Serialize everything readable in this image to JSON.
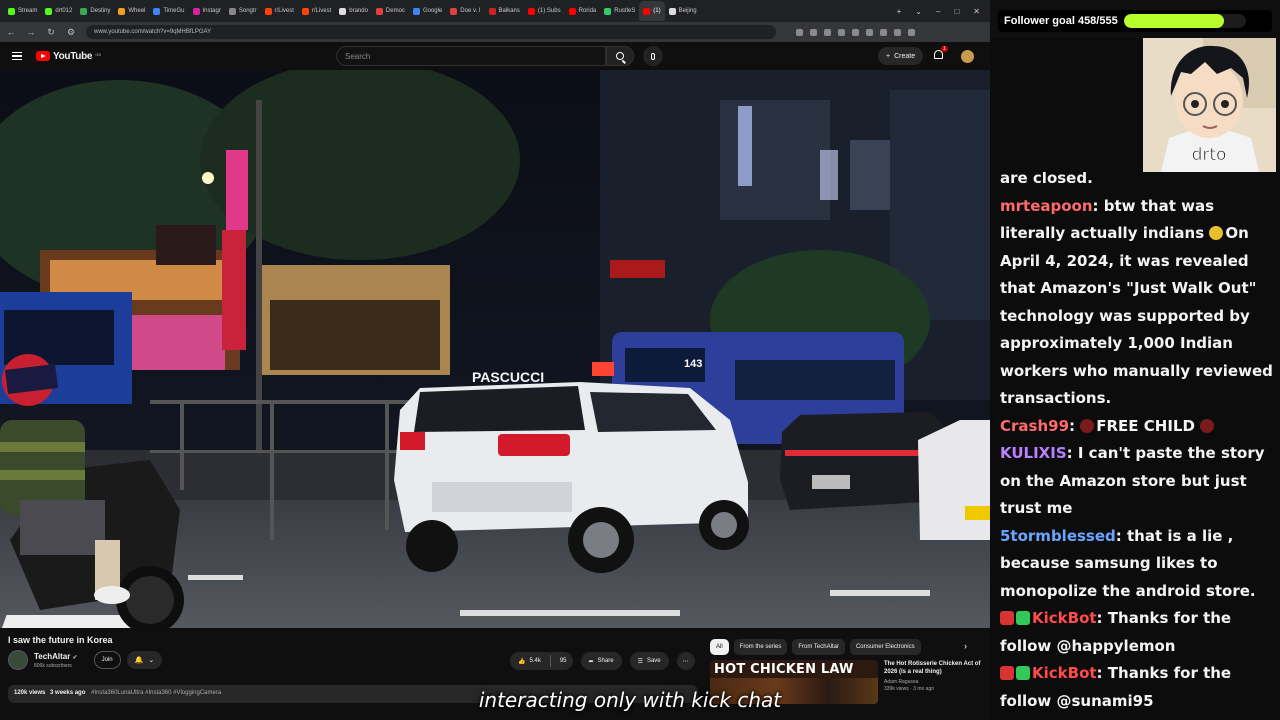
{
  "browser": {
    "tabs": [
      {
        "label": "Stream",
        "color": "#53fc18"
      },
      {
        "label": "drt012",
        "color": "#53fc18"
      },
      {
        "label": "Destiny",
        "color": "#3aa757"
      },
      {
        "label": "Wheel",
        "color": "#f0a020"
      },
      {
        "label": "TimeGu",
        "color": "#4285f4"
      },
      {
        "label": "Instagr",
        "color": "#d6249f"
      },
      {
        "label": "Songtr",
        "color": "#888888"
      },
      {
        "label": "r/Livest",
        "color": "#ff4500"
      },
      {
        "label": "r/Livest",
        "color": "#ff4500"
      },
      {
        "label": "brando",
        "color": "#dddddd"
      },
      {
        "label": "Democ",
        "color": "#e04040"
      },
      {
        "label": "Google",
        "color": "#4285f4"
      },
      {
        "label": "Doe v. I",
        "color": "#e04040"
      },
      {
        "label": "Balkans",
        "color": "#cc2222"
      },
      {
        "label": "(1) Subs",
        "color": "#ff0000"
      },
      {
        "label": "Rorida",
        "color": "#ff0000"
      },
      {
        "label": "RustleS",
        "color": "#33cc66"
      },
      {
        "label": "(1)",
        "color": "#ff0000",
        "active": true
      },
      {
        "label": "Beijing",
        "color": "#dddddd"
      }
    ],
    "url": "www.youtube.com/watch?v=9qMHBfLPGAY"
  },
  "youtube": {
    "logo_text": "YouTube",
    "country": "GB",
    "search_placeholder": "Search",
    "create_label": "Create",
    "notification_count": "1"
  },
  "video": {
    "title": "I saw the future in Korea",
    "channel_name": "TechAltar",
    "subscribers": "806k subscribers",
    "join_label": "Join",
    "likes": "5.4k",
    "comments": "95",
    "share_label": "Share",
    "save_label": "Save",
    "views": "120k views",
    "age": "3 weeks ago",
    "hashtags": "#Insta360LunaUltra #Insta360 #VloggingCamera",
    "signs": {
      "pascucci": "PASCUCCI",
      "bus_number": "143"
    }
  },
  "subtitle": "interacting only with kick chat",
  "related": {
    "chips": [
      "All",
      "From the series",
      "From TechAltar",
      "Consumer Electronics"
    ],
    "items": [
      {
        "thumb_text": "HOT CHICKEN LAW",
        "title": "The Hot Rotisserie Chicken Act of 2026 (is a real thing)",
        "channel": "Adam Ragusea",
        "meta": "339k views · 3 mo ago"
      }
    ]
  },
  "stream": {
    "goal_label": "Follower goal 458/555",
    "goal_fraction": 0.825,
    "goal_color": "#b6ff2d",
    "cam_text": "drto"
  },
  "chat": [
    {
      "text": "are closed."
    },
    {
      "user": "mrteapoon",
      "user_color": "#ff6b6b",
      "text": "btw that was literally actually indians",
      "emote_after": "duck",
      "tail": "On April 4, 2024, it was revealed that Amazon's \"Just Walk Out\" technology was supported by approximately 1,000 Indian workers who manually reviewed transactions."
    },
    {
      "user": "Crash99",
      "user_color": "#ff6b6b",
      "emote_before": "dot",
      "text": "FREE CHILD",
      "emote_after": "dot"
    },
    {
      "user": "KULIXIS",
      "user_color": "#b980ff",
      "text": "I can't paste the story on the Amazon store but just trust me"
    },
    {
      "user": "5tormblessed",
      "user_color": "#6aa6ff",
      "text": "that is a lie , because samsung likes to monopolize the android store."
    },
    {
      "badges": [
        "star",
        "check"
      ],
      "user": "KickBot",
      "user_color": "#ff4b4b",
      "text": "Thanks for the follow @happylemon"
    },
    {
      "badges": [
        "star",
        "check"
      ],
      "user": "KickBot",
      "user_color": "#ff4b4b",
      "text": "Thanks for the follow @sunami95"
    }
  ]
}
